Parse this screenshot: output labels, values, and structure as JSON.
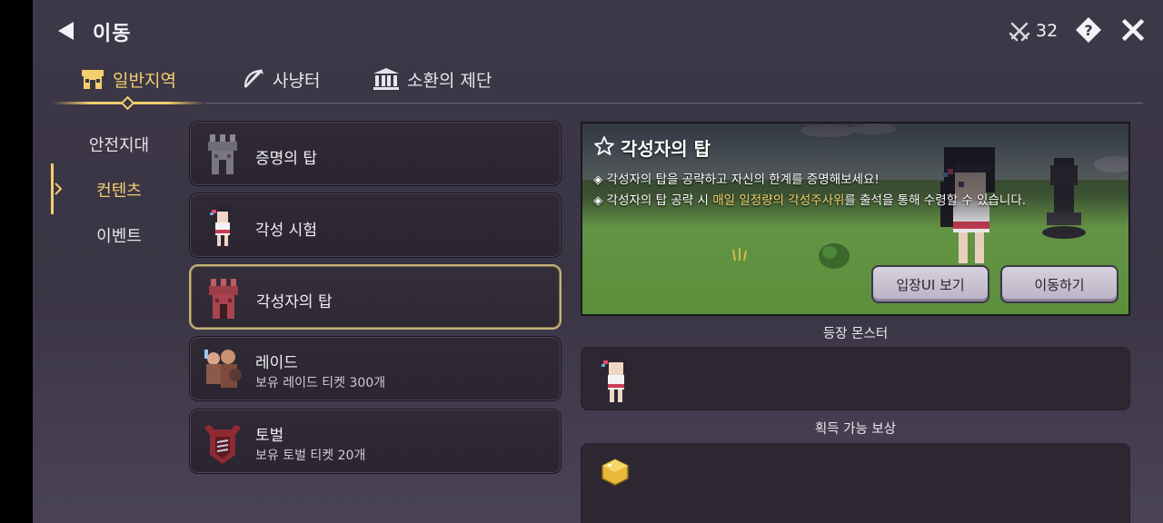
{
  "header": {
    "title": "이동",
    "stamina_value": "32"
  },
  "tabs": [
    {
      "label": "일반지역",
      "active": true
    },
    {
      "label": "사냥터",
      "active": false
    },
    {
      "label": "소환의 제단",
      "active": false
    }
  ],
  "side_nav": {
    "items": [
      {
        "label": "안전지대",
        "active": false
      },
      {
        "label": "컨텐츠",
        "active": true
      },
      {
        "label": "이벤트",
        "active": false
      }
    ]
  },
  "list": {
    "items": [
      {
        "title": "증명의 탑",
        "subtitle": "",
        "icon": "gray-tower-icon"
      },
      {
        "title": "각성 시험",
        "subtitle": "",
        "icon": "girl-character-icon"
      },
      {
        "title": "각성자의 탑",
        "subtitle": "",
        "icon": "red-tower-icon",
        "selected": true
      },
      {
        "title": "레이드",
        "subtitle": "보유 레이드 티켓 300개",
        "icon": "raid-party-icon"
      },
      {
        "title": "토벌",
        "subtitle": "보유 토벌 티켓 20개",
        "icon": "crest-banner-icon"
      }
    ]
  },
  "detail": {
    "title": "각성자의 탑",
    "line1": "◈ 각성자의 탑을 공략하고 자신의 한계를 증명해보세요!",
    "line2_before": "◈ 각성자의 탑 공략 시 ",
    "line2_highlight": "매일 일정량의 각성주사위",
    "line2_after": "를 출석을 통해 수령할 수 있습니다.",
    "enter_ui_button": "입장UI 보기",
    "move_button": "이동하기",
    "monsters_label": "등장 몬스터",
    "rewards_label": "획득 가능 보상"
  },
  "colors": {
    "accent_gold": "#f3cf6e",
    "highlight_text": "#f3d773",
    "panel_bg": "#3b3646"
  }
}
